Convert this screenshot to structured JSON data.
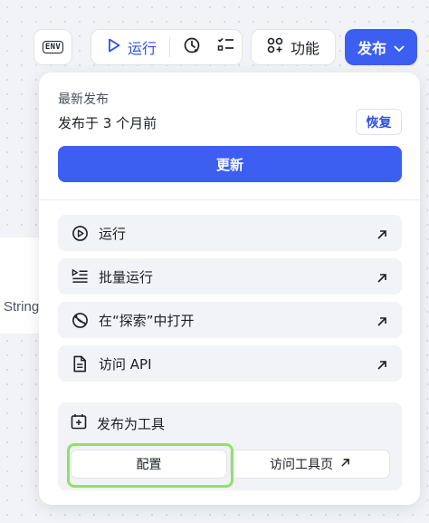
{
  "canvas": {
    "node_text": "String"
  },
  "toolbar": {
    "env_label": "ENV",
    "run_label": "运行",
    "feature_label": "功能",
    "publish_label": "发布"
  },
  "panel": {
    "latest_title": "最新发布",
    "latest_sub": "发布于 3 个月前",
    "restore_label": "恢复",
    "update_label": "更新",
    "menu": [
      {
        "label": "运行"
      },
      {
        "label": "批量运行"
      },
      {
        "label": "在“探索”中打开"
      },
      {
        "label": "访问 API"
      }
    ],
    "tool": {
      "title": "发布为工具",
      "config_label": "配置",
      "visit_label": "访问工具页"
    }
  },
  "colors": {
    "accent": "#3c5ff2",
    "highlight": "#8fe06b"
  }
}
